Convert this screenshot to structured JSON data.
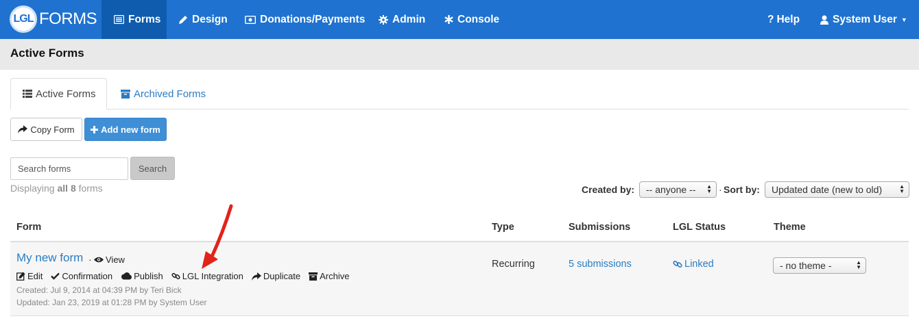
{
  "brand": {
    "badge": "LGL",
    "text": "FORMS"
  },
  "nav": {
    "forms": "Forms",
    "design": "Design",
    "donations": "Donations/Payments",
    "admin": "Admin",
    "console": "Console",
    "help": "Help",
    "user": "System User"
  },
  "page": {
    "title": "Active Forms"
  },
  "tabs": {
    "active": "Active Forms",
    "archived": "Archived Forms"
  },
  "toolbar": {
    "copy": "Copy Form",
    "add": "Add new form"
  },
  "search": {
    "placeholder": "Search forms",
    "button": "Search"
  },
  "count": {
    "prefix": "Displaying ",
    "bold": "all 8",
    "suffix": " forms"
  },
  "filters": {
    "created_label": "Created by:",
    "created_value": "-- anyone --",
    "separator": "·",
    "sort_label": "Sort by:",
    "sort_value": "Updated date (new to old)"
  },
  "table": {
    "headers": {
      "form": "Form",
      "type": "Type",
      "submissions": "Submissions",
      "status": "LGL Status",
      "theme": "Theme"
    },
    "row": {
      "name": "My new form",
      "dot": "·",
      "view": "View",
      "actions": {
        "edit": "Edit",
        "confirmation": "Confirmation",
        "publish": "Publish",
        "integration": "LGL Integration",
        "duplicate": "Duplicate",
        "archive": "Archive"
      },
      "created": "Created: Jul 9, 2014 at 04:39 PM by Teri Bick",
      "updated": "Updated: Jan 23, 2019 at 01:28 PM by System User",
      "type": "Recurring",
      "submissions": "5 submissions",
      "status": "Linked",
      "theme": "- no theme -"
    }
  },
  "colors": {
    "nav": "#1f72cf",
    "nav_active": "#0f5cae",
    "link": "#2a7cc4",
    "primary": "#3f8fd6",
    "arrow": "#e2231a"
  }
}
